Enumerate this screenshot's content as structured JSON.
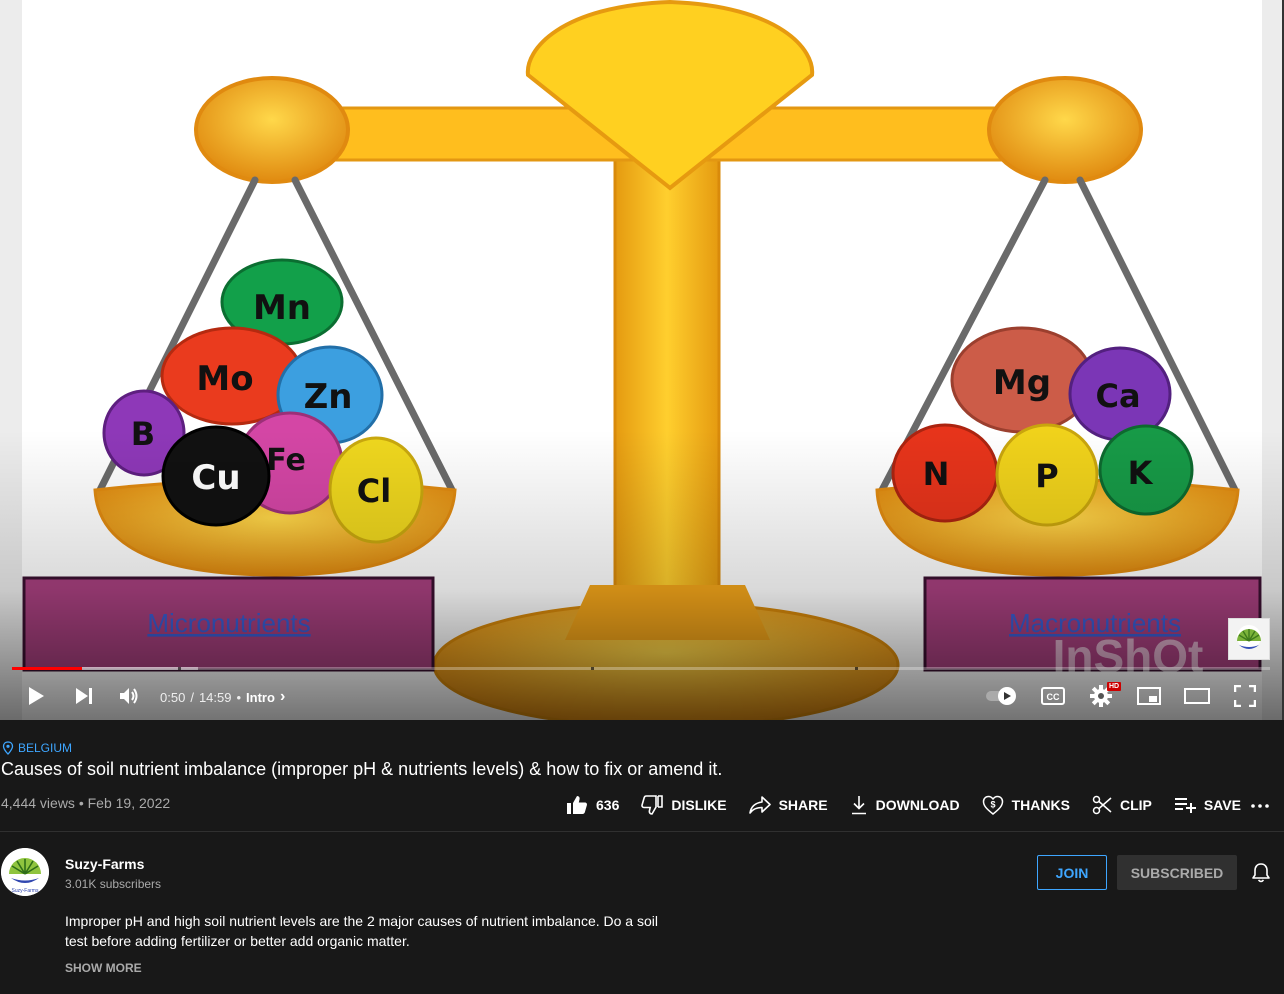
{
  "video": {
    "frame": {
      "left_balls": [
        "Mn",
        "Mo",
        "Zn",
        "B",
        "Cu",
        "Fe",
        "Cl"
      ],
      "right_balls": [
        "Mg",
        "Ca",
        "N",
        "P",
        "K"
      ],
      "left_label": "Micronutrients",
      "right_label": "Macronutrients",
      "watermark_text": "InShOt"
    },
    "progress": {
      "played_fraction": 0.056
    },
    "controls": {
      "current_time": "0:50",
      "separator": "/",
      "duration": "14:59",
      "dot": "•",
      "chapter": "Intro",
      "chapter_chevron": "›",
      "hd_badge": "HD",
      "cc_label": "CC",
      "icons": [
        "play-icon",
        "next-icon",
        "volume-icon",
        "autoplay-toggle-icon",
        "cc-icon",
        "settings-icon",
        "miniplayer-icon",
        "theater-icon",
        "fullscreen-icon"
      ]
    }
  },
  "location": "BELGIUM",
  "title": "Causes of soil nutrient imbalance (improper pH & nutrients levels) & how to fix or amend it.",
  "meta": {
    "views": "4,444 views",
    "dot": "•",
    "date": "Feb 19, 2022"
  },
  "actions": {
    "like_count": "636",
    "dislike": "DISLIKE",
    "share": "SHARE",
    "download": "DOWNLOAD",
    "thanks": "THANKS",
    "clip": "CLIP",
    "save": "SAVE",
    "more": "⋯"
  },
  "channel": {
    "name": "Suzy-Farms",
    "subscribers": "3.01K subscribers",
    "avatar_text": "Suzy-Farms",
    "join": "JOIN",
    "subscribed": "SUBSCRIBED"
  },
  "description": {
    "text": "Improper pH and high soil nutrient levels are the 2 major causes of nutrient imbalance. Do a soil test before adding fertilizer or better add organic matter.",
    "show_more": "SHOW MORE"
  },
  "colors": {
    "accent_blue": "#3ea6ff",
    "progress_red": "#ff0000",
    "background": "#181818",
    "label_box": "#a8407f"
  }
}
